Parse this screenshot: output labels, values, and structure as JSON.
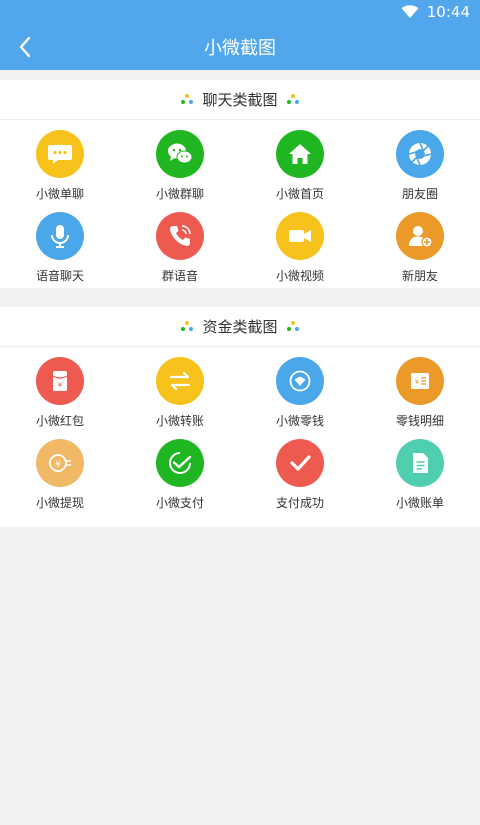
{
  "status_bar": {
    "time": "10:44",
    "wifi_icon": "wifi-icon"
  },
  "app_bar": {
    "title": "小微截图",
    "back_icon": "back-arrow-icon"
  },
  "sections": [
    {
      "title": "聊天类截图",
      "items": [
        {
          "label": "小微单聊",
          "icon": "chat-bubble-icon",
          "color": "#f6c21b"
        },
        {
          "label": "小微群聊",
          "icon": "wechat-icon",
          "color": "#1fb622"
        },
        {
          "label": "小微首页",
          "icon": "home-icon",
          "color": "#1fb622"
        },
        {
          "label": "朋友圈",
          "icon": "aperture-icon",
          "color": "#4aa8ea"
        },
        {
          "label": "语音聊天",
          "icon": "microphone-icon",
          "color": "#4aa8ea"
        },
        {
          "label": "群语音",
          "icon": "phone-icon",
          "color": "#ef5a50"
        },
        {
          "label": "小微视频",
          "icon": "video-camera-icon",
          "color": "#f6c21b"
        },
        {
          "label": "新朋友",
          "icon": "add-friend-icon",
          "color": "#eb9a2a"
        }
      ]
    },
    {
      "title": "资金类截图",
      "items": [
        {
          "label": "小微红包",
          "icon": "red-packet-icon",
          "color": "#ef5a50"
        },
        {
          "label": "小微转账",
          "icon": "transfer-icon",
          "color": "#f6c21b"
        },
        {
          "label": "小微零钱",
          "icon": "wallet-icon",
          "color": "#4aa8ea"
        },
        {
          "label": "零钱明细",
          "icon": "ledger-icon",
          "color": "#eb9a2a"
        },
        {
          "label": "小微提现",
          "icon": "withdraw-icon",
          "color": "#f1b866"
        },
        {
          "label": "小微支付",
          "icon": "payment-check-icon",
          "color": "#1fb622"
        },
        {
          "label": "支付成功",
          "icon": "success-check-icon",
          "color": "#ef5a50"
        },
        {
          "label": "小微账单",
          "icon": "bill-icon",
          "color": "#4fcfb0"
        }
      ]
    }
  ]
}
